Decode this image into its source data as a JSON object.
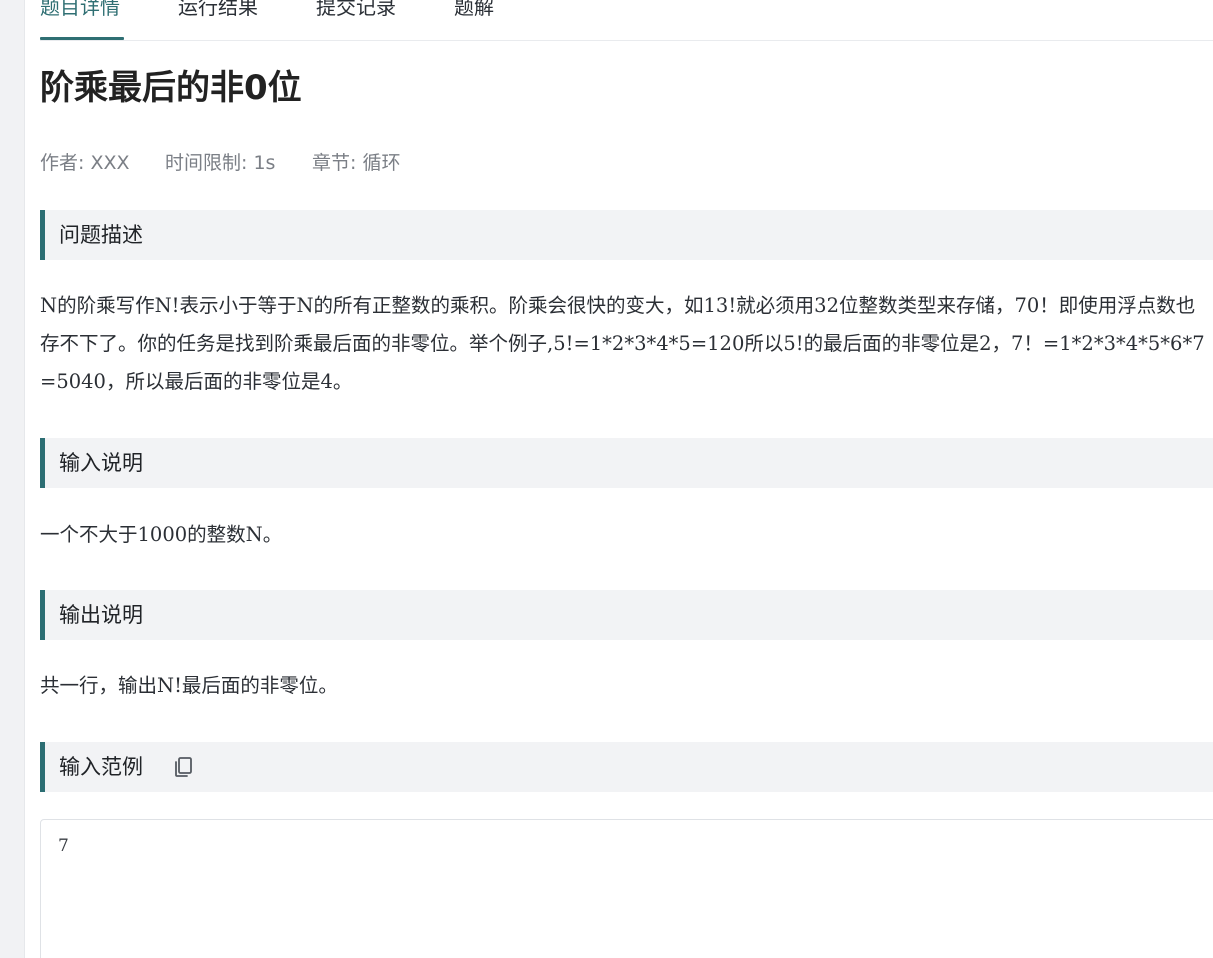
{
  "tabs": [
    {
      "label": "题目详情",
      "active": true
    },
    {
      "label": "运行结果",
      "active": false
    },
    {
      "label": "提交记录",
      "active": false
    },
    {
      "label": "题解",
      "active": false
    }
  ],
  "problem": {
    "title": "阶乘最后的非0位",
    "meta": {
      "author": "作者: XXX",
      "time_limit": "时间限制: 1s",
      "chapter": "章节: 循环"
    }
  },
  "sections": {
    "description": {
      "header": "问题描述",
      "text": "N的阶乘写作N!表示小于等于N的所有正整数的乘积。阶乘会很快的变大，如13!就必须用32位整数类型来存储，70！即使用浮点数也存不下了。你的任务是找到阶乘最后面的非零位。举个例子,5!=1*2*3*4*5=120所以5!的最后面的非零位是2，7！=1*2*3*4*5*6*7=5040，所以最后面的非零位是4。"
    },
    "input": {
      "header": "输入说明",
      "text": "一个不大于1000的整数N。"
    },
    "output": {
      "header": "输出说明",
      "text": "共一行，输出N!最后面的非零位。"
    },
    "sample_input": {
      "header": "输入范例",
      "value": "7"
    }
  },
  "icons": {
    "copy": "copy-icon"
  },
  "colors": {
    "accent": "#2f6f73",
    "section_bar": "#2c6e73",
    "section_bg": "#f2f3f5",
    "meta_text": "#7b7f86"
  }
}
